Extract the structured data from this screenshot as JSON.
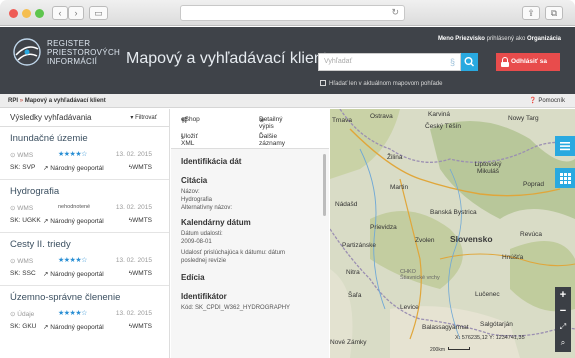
{
  "header": {
    "logo_lines": [
      "REGISTER",
      "PRIESTOROVÝCH",
      "INFORMÁCIÍ"
    ],
    "app_title": "Mapový a vyhľadávací klient",
    "user_name": "Meno Priezvisko",
    "user_middle": " prihlásený ako ",
    "user_role": "Organizácia",
    "search_placeholder": "Vyhľadať",
    "search_clear": "§",
    "logout_label": "Odhlásiť sa",
    "checkbox_label": "Hľadať len v aktuálnom mapovom pohľade"
  },
  "breadcrumb": {
    "root": "RPI",
    "separator": "»",
    "current": "Mapový a vyhľadávací klient",
    "help": "Pomocník"
  },
  "results": {
    "title": "Výsledky vyhľadávania",
    "filter": "Filtrovať",
    "items": [
      {
        "title": "Inundačné územie",
        "type": "WMS",
        "rating": "★★★★☆",
        "date": "13. 02. 2015",
        "code": "SK: SVP",
        "geoportal": "Národný geoportál",
        "wmts": "WMTS"
      },
      {
        "title": "Hydrografia",
        "type": "WMS",
        "rating": "nehodnotené",
        "date": "13. 02. 2015",
        "code": "SK: UGKK",
        "geoportal": "Národný geoportál",
        "wmts": "WMTS"
      },
      {
        "title": "Cesty II. triedy",
        "type": "WMS",
        "rating": "★★★★☆",
        "date": "13. 02. 2015",
        "code": "SK: SSC",
        "geoportal": "Národný geoportál",
        "wmts": "WMTS"
      },
      {
        "title": "Územno-správne členenie",
        "type": "Údaje",
        "rating": "★★★★☆",
        "date": "13. 02. 2015",
        "code": "SK: GKU",
        "geoportal": "Národný geoportál",
        "wmts": "WMTS"
      }
    ]
  },
  "details": {
    "actions": {
      "eshop": "eShop",
      "detail": "Detailný výpis",
      "xml": "Uložiť XML",
      "more": "Ďalšie záznamy"
    },
    "sections": {
      "identification": "Identifikácia dát",
      "citation": "Citácia",
      "name_label": "Názov:",
      "name_value": "Hydrografia",
      "alt_name_label": "Alternatívny názov:",
      "calendar": "Kalendárny dátum",
      "event_label": "Dátum udalosti:",
      "event_value": "2009-08-01",
      "event_desc": "Udalosť prislúchajúca k dátumu: dátum poslednej revízie",
      "edition": "Edícia",
      "identifier": "Identifikátor",
      "code": "Kód: SK_CPDI_W362_HYDROGRAPHY"
    }
  },
  "map": {
    "labels": [
      "Ostrava",
      "Český Těšín",
      "Nowy Targ",
      "Karviná",
      "Žilina",
      "Martin",
      "Liptovský Mikuláš",
      "Poprad",
      "Zvolen",
      "Prievidza",
      "Slovensko",
      "Revúca",
      "Partizánske",
      "Banská Bystrica",
      "Hnúšťa",
      "Nitra",
      "CHKO Štiavnické vrchy",
      "Lučenec",
      "Šaľa",
      "Levice",
      "Balassagyarmat",
      "Salgótarján",
      "Nové Zámky",
      "Trnava",
      "Nádašd"
    ],
    "coords": "X: 576235,12 Y: 1234741,35",
    "scale": "200km",
    "zoom_in": "+",
    "zoom_out": "−"
  },
  "colors": {
    "header_bg": "#3f4349",
    "accent": "#29a9e0",
    "danger": "#e84c4c",
    "link": "#2a8fd4"
  }
}
